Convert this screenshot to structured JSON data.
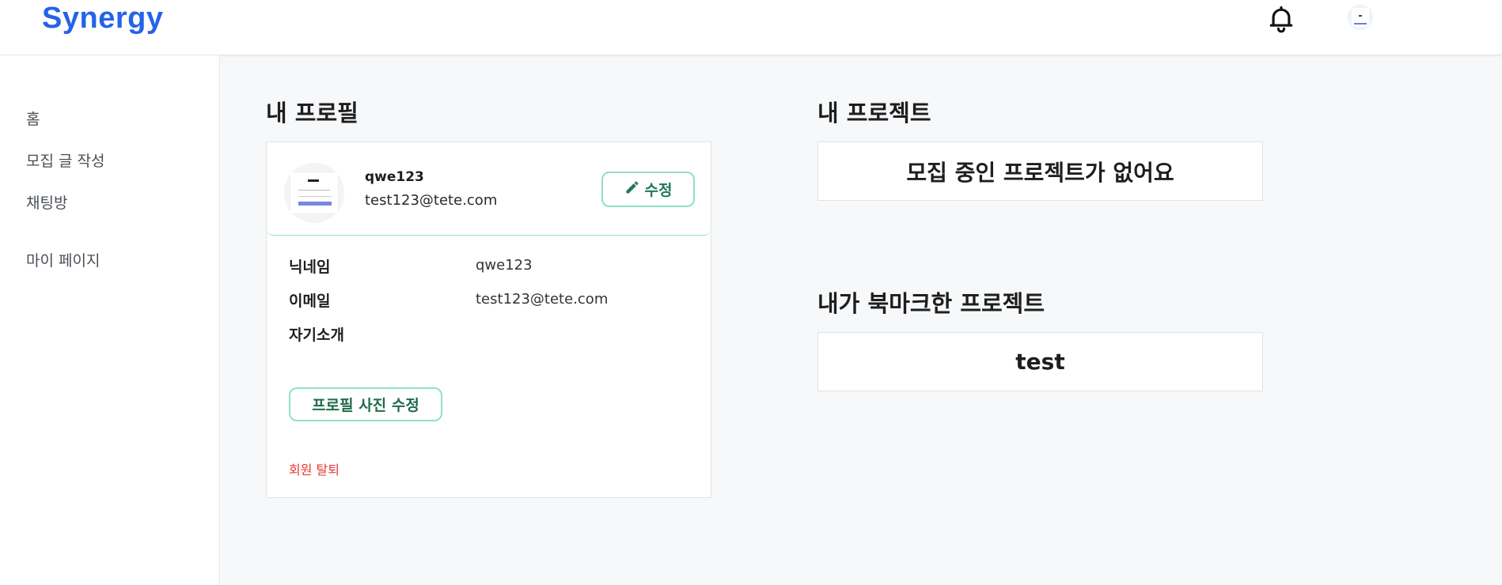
{
  "header": {
    "logo": "Synergy",
    "bell_icon": "bell-icon",
    "avatar_icon": "user-avatar"
  },
  "sidebar": {
    "items": [
      {
        "label": "홈"
      },
      {
        "label": "모집 글 작성"
      },
      {
        "label": "채팅방"
      },
      {
        "label": "마이 페이지"
      }
    ]
  },
  "profile": {
    "title": "내 프로필",
    "username": "qwe123",
    "email": "test123@tete.com",
    "edit_label": "수정",
    "edit_icon": "pencil-icon",
    "fields": [
      {
        "label": "닉네임",
        "value": "qwe123"
      },
      {
        "label": "이메일",
        "value": "test123@tete.com"
      },
      {
        "label": "자기소개",
        "value": ""
      }
    ],
    "photo_button": "프로필 사진 수정",
    "withdraw": "회원 탈퇴"
  },
  "projects": {
    "title": "내 프로젝트",
    "empty_text": "모집 중인 프로젝트가 없어요"
  },
  "bookmarks": {
    "title": "내가 북마크한 프로젝트",
    "items": [
      "test"
    ]
  },
  "colors": {
    "brand": "#2563e8",
    "accent_border": "#8fe0c6",
    "accent_text": "#1f7a55",
    "danger": "#e53935"
  }
}
